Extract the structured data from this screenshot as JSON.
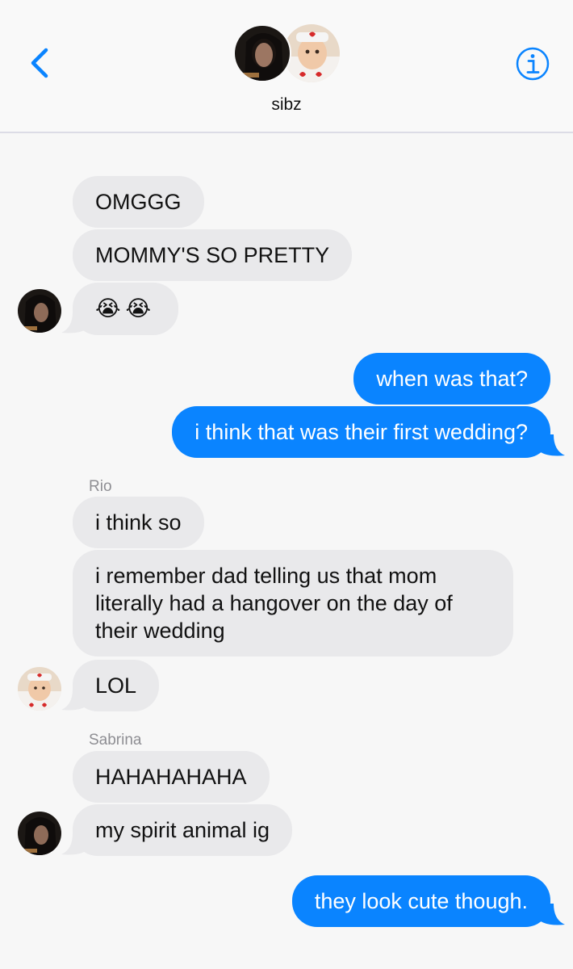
{
  "header": {
    "contact_name": "sibz",
    "back_icon": "chevron-left-icon",
    "info_icon": "info-circle-icon",
    "accent_color": "#0a84ff"
  },
  "messages": [
    {
      "id": "m1",
      "direction": "incoming",
      "text": "OMGGG"
    },
    {
      "id": "m2",
      "direction": "incoming",
      "text": "MOMMY'S SO PRETTY"
    },
    {
      "id": "m3",
      "direction": "incoming",
      "text": "😭😭",
      "emoji": [
        "loudly-crying-face",
        "loudly-crying-face"
      ]
    },
    {
      "id": "m4",
      "direction": "outgoing",
      "text": "when was that?"
    },
    {
      "id": "m5",
      "direction": "outgoing",
      "text": "i think that was their first wedding?"
    },
    {
      "id": "s1",
      "type": "sender-label",
      "text": "Rio"
    },
    {
      "id": "m6",
      "direction": "incoming",
      "text": "i think so"
    },
    {
      "id": "m7",
      "direction": "incoming",
      "text": "i remember dad telling us that mom literally had a hangover on the day of their wedding"
    },
    {
      "id": "m8",
      "direction": "incoming",
      "text": "LOL"
    },
    {
      "id": "s2",
      "type": "sender-label",
      "text": "Sabrina"
    },
    {
      "id": "m9",
      "direction": "incoming",
      "text": "HAHAHAHAHA"
    },
    {
      "id": "m10",
      "direction": "incoming",
      "text": "my spirit animal ig"
    },
    {
      "id": "m11",
      "direction": "outgoing",
      "text": "they look cute though."
    }
  ],
  "colors": {
    "incoming_bubble": "#e9e9eb",
    "outgoing_bubble": "#0a84ff",
    "sender_label": "#8e8e93"
  }
}
